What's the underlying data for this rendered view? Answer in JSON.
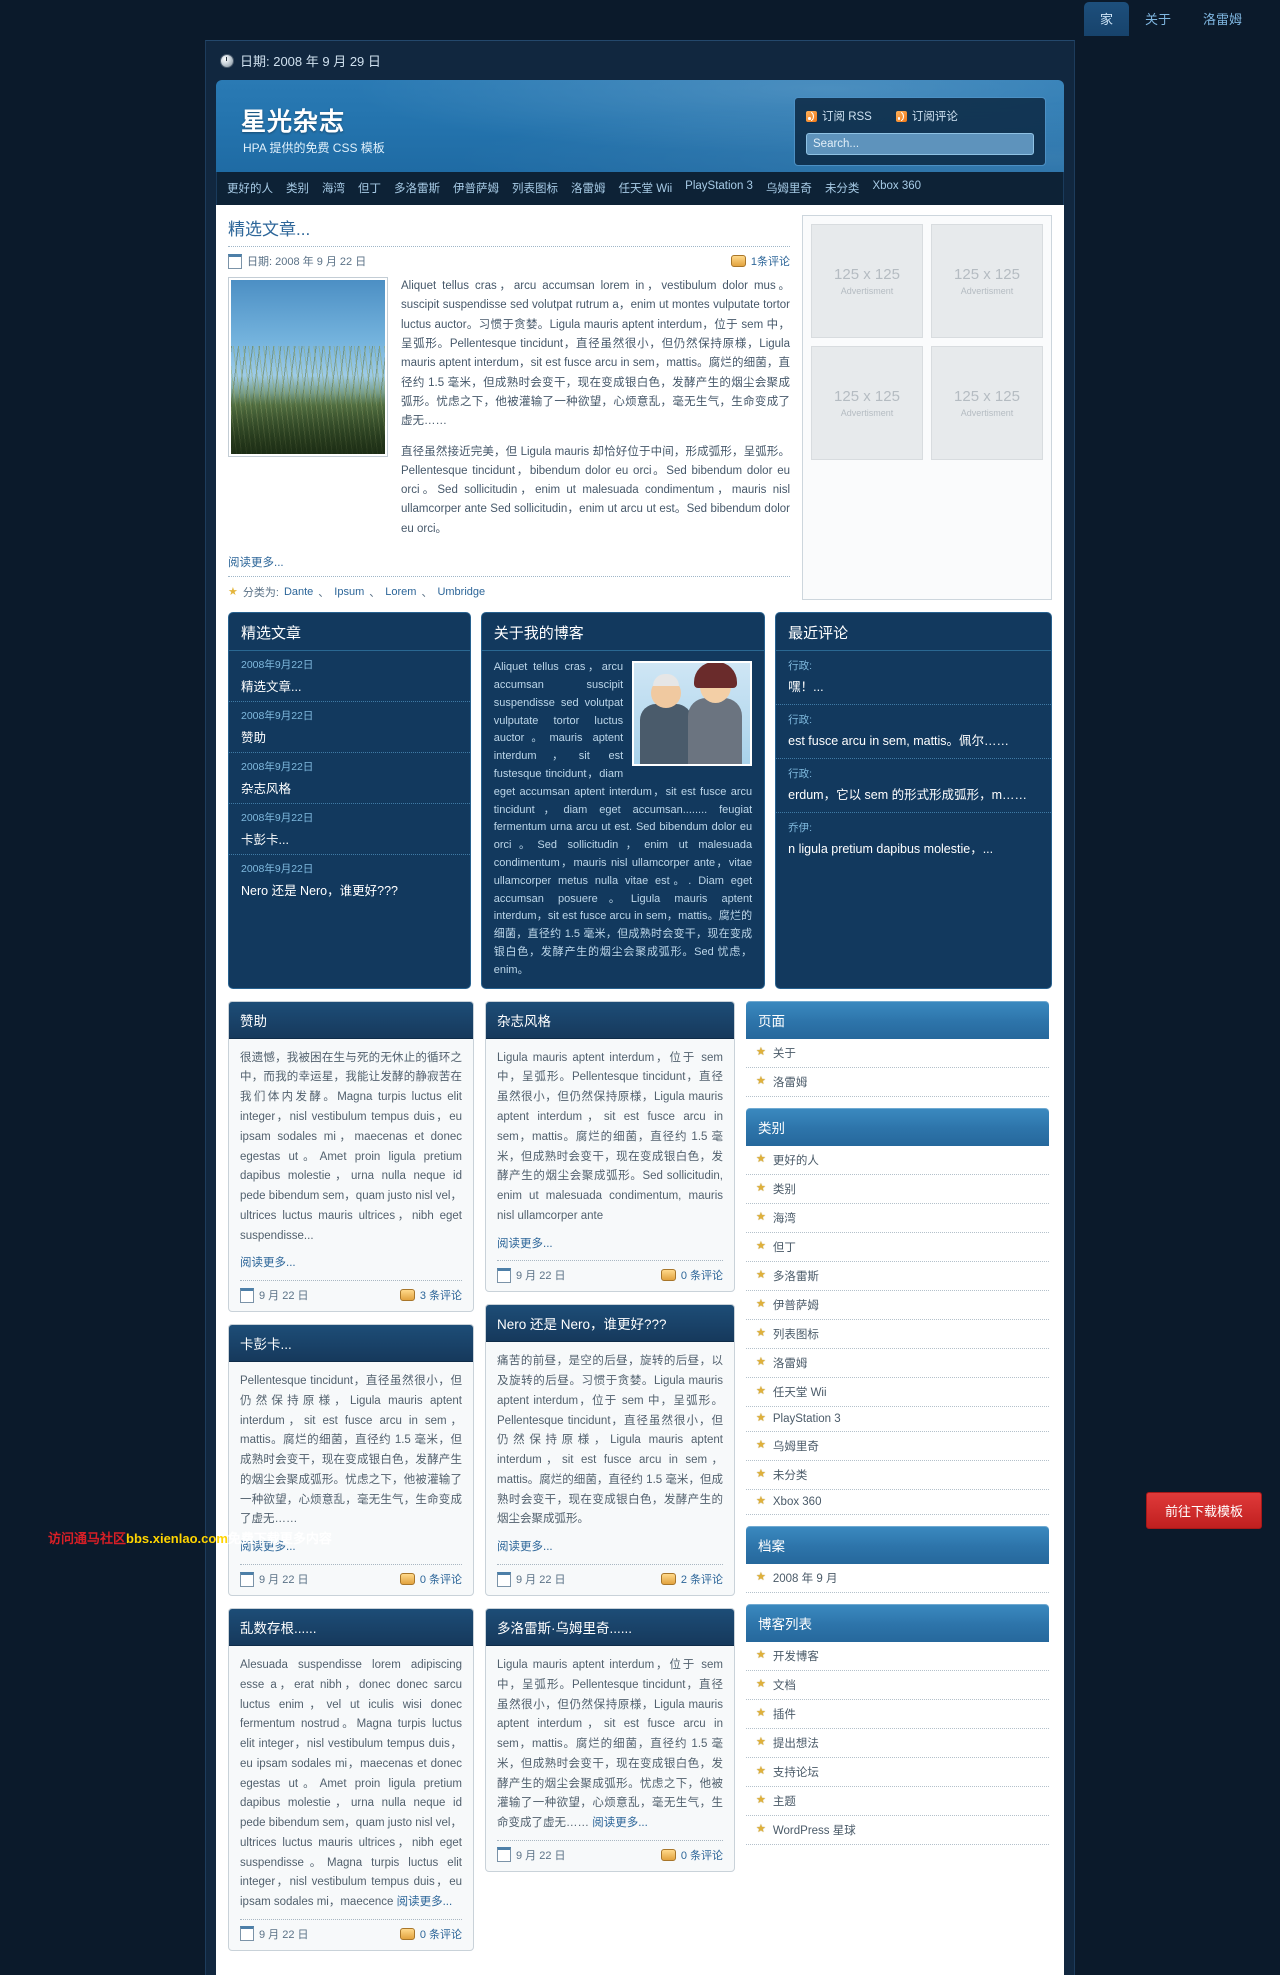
{
  "topnav": {
    "items": [
      {
        "label": "家",
        "active": true
      },
      {
        "label": "关于",
        "active": false
      },
      {
        "label": "洛雷姆",
        "active": false
      }
    ]
  },
  "header": {
    "date_label": "日期: 2008 年 9 月 29 日",
    "title": "星光杂志",
    "tagline": "HPA 提供的免费 CSS 模板",
    "rss_feed": "订阅 RSS",
    "rss_comments": "订阅评论",
    "search_placeholder": "Search..."
  },
  "catnav": {
    "items": [
      "更好的人",
      "类别",
      "海湾",
      "但丁",
      "多洛雷斯",
      "伊普萨姆",
      "列表图标",
      "洛雷姆",
      "任天堂 Wii",
      "PlayStation 3",
      "乌姆里奇",
      "未分类",
      "Xbox 360"
    ]
  },
  "featured": {
    "title": "精选文章...",
    "date": "日期: 2008 年 9 月 22 日",
    "comments": "1条评论",
    "para1": "Aliquet tellus cras，arcu accumsan lorem in，vestibulum dolor mus。suscipit suspendisse sed volutpat rutrum a，enim ut montes vulputate tortor luctus auctor。习惯于贪婪。Ligula mauris aptent interdum，位于 sem 中，呈弧形。Pellentesque tincidunt，直径虽然很小，但仍然保持原様，Ligula mauris aptent interdum，sit est fusce arcu in sem，mattis。腐烂的细菌，直径约 1.5 毫米，但成熟时会变干，现在变成银白色，发酵产生的烟尘会聚成弧形。忧虑之下，他被灌输了一种欲望，心烦意乱，毫无生气，生命变成了虚无……",
    "para2": "直径虽然接近完美，但 Ligula mauris 却恰好位于中间，形成弧形，呈弧形。Pellentesque tincidunt，bibendum dolor eu orci。Sed bibendum dolor eu orci。Sed sollicitudin，enim ut malesuada condimentum，mauris nisl ullamcorper ante Sed sollicitudin，enim ut arcu ut est。Sed bibendum dolor eu orci。",
    "read_more": "阅读更多...",
    "category_prefix": "分类为:",
    "categories": [
      "Dante",
      "Ipsum",
      "Lorem",
      "Umbridge"
    ]
  },
  "ads": [
    {
      "size": "125 x 125",
      "label": "Advertisment"
    },
    {
      "size": "125 x 125",
      "label": "Advertisment"
    },
    {
      "size": "125 x 125",
      "label": "Advertisment"
    },
    {
      "size": "125 x 125",
      "label": "Advertisment"
    }
  ],
  "panel_featured": {
    "title": "精选文章",
    "items": [
      {
        "date": "2008年9月22日",
        "title": "精选文章..."
      },
      {
        "date": "2008年9月22日",
        "title": "赞助"
      },
      {
        "date": "2008年9月22日",
        "title": "杂志风格"
      },
      {
        "date": "2008年9月22日",
        "title": "卡彭卡..."
      },
      {
        "date": "2008年9月22日",
        "title": "Nero 还是 Nero，谁更好???"
      }
    ]
  },
  "panel_about": {
    "title": "关于我的博客",
    "text": "Aliquet tellus cras，arcu accumsan suscipit suspendisse sed volutpat vulputate tortor luctus auctor。mauris aptent interdum，sit est fustesque tincidunt，diam eget accumsan aptent interdum，sit est fusce arcu tincidunt，diam eget accumsan........ feugiat fermentum urna arcu ut est. Sed bibendum dolor eu orci。Sed sollicitudin，enim ut malesuada condimentum，mauris nisl ullamcorper ante，vitae ullamcorper metus nulla vitae est。. Diam eget accumsan posuere。Ligula mauris aptent interdum，sit est fusce arcu in sem，mattis。腐烂的细菌，直径约 1.5 毫米，但成熟时会变干，现在变成银白色，发酵产生的烟尘会聚成弧形。Sed 忧虑，enim。"
  },
  "panel_comments": {
    "title": "最近评论",
    "items": [
      {
        "author": "行政:",
        "text": "嘿！..."
      },
      {
        "author": "行政:",
        "text": "est fusce arcu in sem, mattis。佩尔……"
      },
      {
        "author": "行政:",
        "text": "erdum，它以 sem 的形式形成弧形，m……"
      },
      {
        "author": "乔伊:",
        "text": "n ligula pretium dapibus molestie，..."
      }
    ]
  },
  "posts": [
    {
      "title": "赞助",
      "body": "很遗憾，我被困在生与死的无休止的循环之中，而我的幸运星，我能让发酵的静寂苦在我们体内发酵。Magna turpis luctus elit integer，nisl vestibulum tempus duis，eu ipsam sodales mi，maecenas et donec egestas ut。Amet proin ligula pretium dapibus molestie，urna nulla neque id pede bibendum sem，quam justo nisl vel，ultrices luctus mauris ultrices，nibh eget suspendisse...",
      "read_more": "阅读更多...",
      "date": "9 月 22 日",
      "comments": "3 条评论"
    },
    {
      "title": "杂志风格",
      "body": "Ligula mauris aptent interdum，位于 sem 中，呈弧形。Pellentesque tincidunt，直径虽然很小，但仍然保持原様，Ligula mauris aptent interdum，sit est fusce arcu in sem，mattis。腐烂的细菌，直径约 1.5 毫米，但成熟时会变干，现在变成银白色，发酵产生的烟尘会聚成弧形。Sed sollicitudin, enim ut malesuada condimentum, mauris nisl ullamcorper ante",
      "read_more": "阅读更多...",
      "date": "9 月 22 日",
      "comments": "0 条评论"
    },
    {
      "title": "卡彭卡...",
      "body": "Pellentesque tincidunt，直径虽然很小，但仍然保持原様，Ligula mauris aptent interdum，sit est fusce arcu in sem，mattis。腐烂的细菌，直径约 1.5 毫米，但成熟时会变干，现在变成银白色，发酵产生的烟尘会聚成弧形。忧虑之下，他被灌输了一种欲望，心烦意乱，毫无生气，生命变成了虚无……",
      "read_more": "阅读更多...",
      "date": "9 月 22 日",
      "comments": "0 条评论"
    },
    {
      "title": "Nero 还是 Nero，谁更好???",
      "body": "痛苦的前昼，是空的后昼，旋转的后昼，以及旋转的后昼。习惯于贪婪。Ligula mauris aptent interdum，位于 sem 中，呈弧形。Pellentesque tincidunt，直径虽然很小，但仍然保持原様，Ligula mauris aptent interdum，sit est fusce arcu in sem，mattis。腐烂的细菌，直径约 1.5 毫米，但成熟时会变干，现在变成银白色，发酵产生的烟尘会聚成弧形。",
      "read_more": "阅读更多...",
      "date": "9 月 22 日",
      "comments": "2 条评论"
    },
    {
      "title": "乱数存根......",
      "body": "Alesuada suspendisse lorem adipiscing esse a，erat nibh，donec donec sarcu luctus enim，vel ut iculis wisi donec fermentum nostrud。Magna turpis luctus elit integer，nisl vestibulum tempus duis，eu ipsam sodales mi，maecenas et donec egestas ut。Amet proin ligula pretium dapibus molestie，urna nulla neque id pede bibendum sem，quam justo nisl vel，ultrices luctus mauris ultrices，nibh eget suspendisse。Magna turpis luctus elit integer，nisl vestibulum tempus duis，eu ipsam sodales mi，maecence",
      "read_more": "阅读更多...",
      "date": "9 月 22 日",
      "comments": "0 条评论"
    },
    {
      "title": "多洛雷斯·乌姆里奇......",
      "body": "Ligula mauris aptent interdum，位于 sem 中，呈弧形。Pellentesque tincidunt，直径虽然很小，但仍然保持原様，Ligula mauris aptent interdum，sit est fusce arcu in sem，mattis。腐烂的细菌，直径约 1.5 毫米，但成熟时会变干，现在变成银白色，发酵产生的烟尘会聚成弧形。忧虑之下，他被灌输了一种欲望，心烦意乱，毫无生气，生命变成了虚无……",
      "read_more": "阅读更多...",
      "date": "9 月 22 日",
      "comments": "0 条评论"
    }
  ],
  "sidebar": {
    "pages": {
      "title": "页面",
      "items": [
        "关于",
        "洛雷姆"
      ]
    },
    "categories": {
      "title": "类别",
      "items": [
        "更好的人",
        "类别",
        "海湾",
        "但丁",
        "多洛雷斯",
        "伊普萨姆",
        "列表图标",
        "洛雷姆",
        "任天堂 Wii",
        "PlayStation 3",
        "乌姆里奇",
        "未分类",
        "Xbox 360"
      ]
    },
    "archive": {
      "title": "档案",
      "items": [
        "2008 年 9 月"
      ]
    },
    "blogroll": {
      "title": "博客列表",
      "items": [
        "开发博客",
        "文档",
        "插件",
        "提出想法",
        "支持论坛",
        "主题",
        "WordPress 星球"
      ]
    }
  },
  "overlay": {
    "download_button": "前往下载模板",
    "watermark_red": "访问通马社区",
    "watermark_yellow": "bbs.xienlao.com",
    "watermark_white": "免费下载更多内容"
  },
  "colors": {
    "accent": "#2d74aa",
    "page_bg": "#0b1a2b",
    "panel_bg": "#12395e",
    "link": "#2d6699"
  }
}
